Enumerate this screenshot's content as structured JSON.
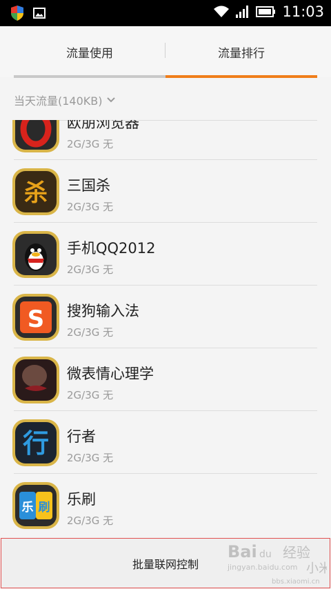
{
  "status_bar": {
    "time": "11:03",
    "icons": [
      "shield-app-icon",
      "image-icon",
      "wifi-icon",
      "signal-icon",
      "battery-icon"
    ]
  },
  "tabs": [
    {
      "label": "流量使用",
      "active": false
    },
    {
      "label": "流量排行",
      "active": true
    }
  ],
  "colors": {
    "accent": "#f07e1a",
    "inactive_tab": "#c9c9c9",
    "button_border": "#e05050"
  },
  "filter": {
    "label": "当天流量(140KB)",
    "icon": "chevron-down-icon"
  },
  "apps": [
    {
      "name": "欧朋浏览器",
      "detail": "2G/3G 无",
      "icon": "opera-browser-icon"
    },
    {
      "name": "三国杀",
      "detail": "2G/3G 无",
      "icon": "sanguosha-icon"
    },
    {
      "name": "手机QQ2012",
      "detail": "2G/3G 无",
      "icon": "qq-penguin-icon"
    },
    {
      "name": "搜狗输入法",
      "detail": "2G/3G 无",
      "icon": "sogou-input-icon"
    },
    {
      "name": "微表情心理学",
      "detail": "2G/3G 无",
      "icon": "micro-expression-icon"
    },
    {
      "name": "行者",
      "detail": "2G/3G 无",
      "icon": "xingzhe-icon"
    },
    {
      "name": "乐刷",
      "detail": "2G/3G 无",
      "icon": "leshua-icon"
    }
  ],
  "bottom_button": {
    "label": "批量联网控制"
  },
  "watermark": {
    "brand": "Bai",
    "paw": "du",
    "cn": "经验",
    "url": "jingyan.baidu.com",
    "site": "bbs.xiaomi.cn",
    "mi": "小米"
  }
}
